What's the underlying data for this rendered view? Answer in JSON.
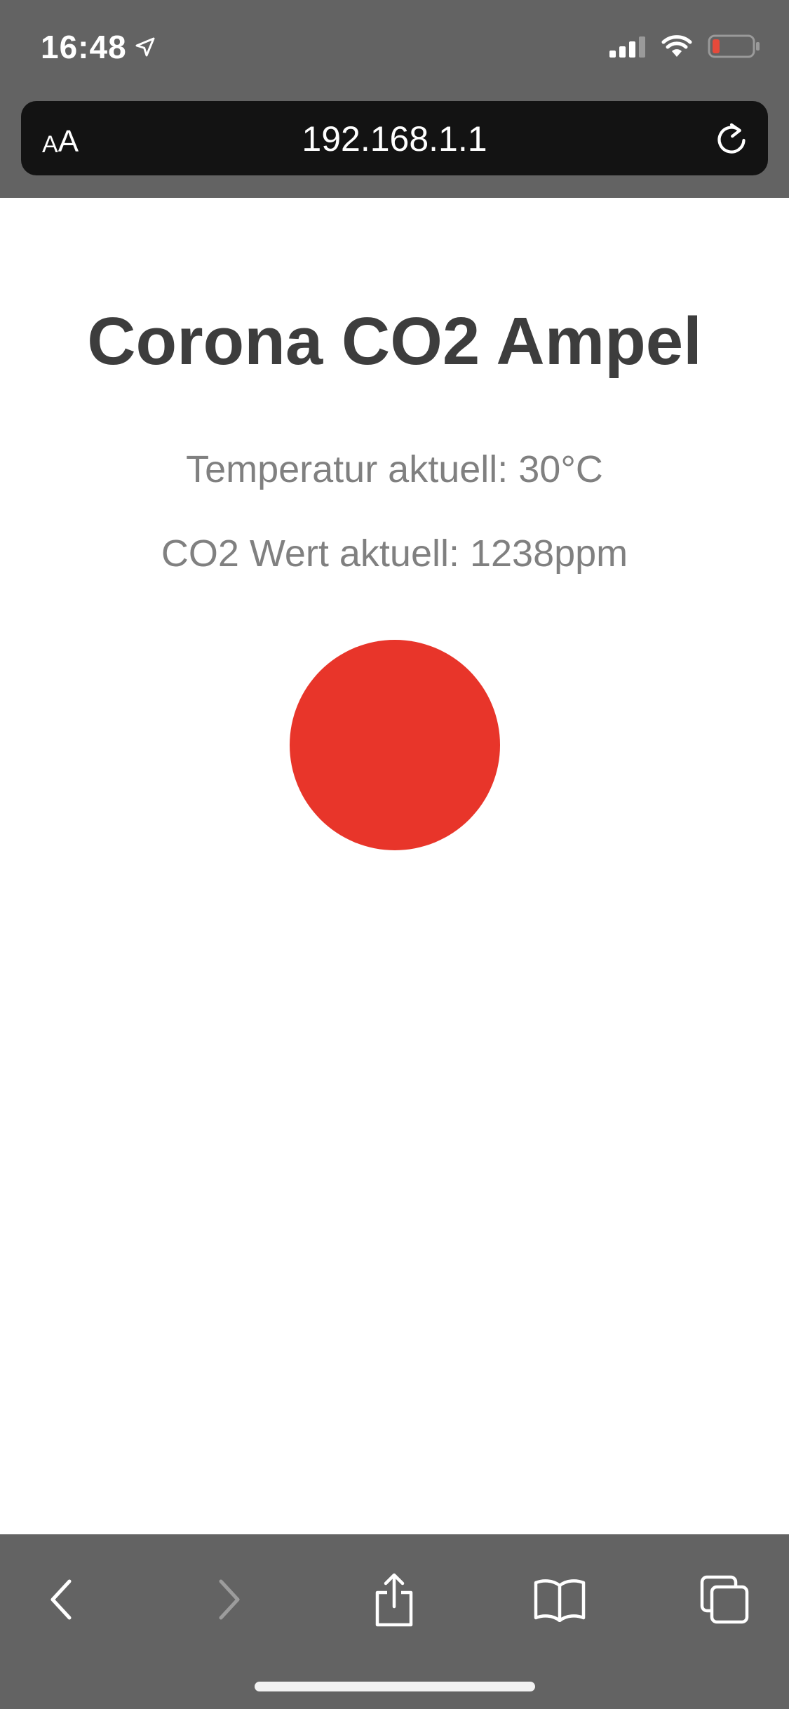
{
  "status_bar": {
    "time": "16:48",
    "icons": [
      "location-arrow-icon",
      "cellular-signal-icon",
      "wifi-icon",
      "battery-low-icon"
    ],
    "battery_color": "#e64a3b"
  },
  "address_bar": {
    "text_size_button": {
      "small": "A",
      "big": "A"
    },
    "url": "192.168.1.1",
    "reload_icon": "reload-icon"
  },
  "page": {
    "title": "Corona CO2 Ampel",
    "temperature_text": "Temperatur aktuell: 30°C",
    "co2_text": "CO2 Wert aktuell: 1238ppm",
    "traffic_light_color": "#e8352a"
  },
  "toolbar": {
    "buttons": [
      {
        "icon": "back-chevron-icon",
        "enabled": true
      },
      {
        "icon": "forward-chevron-icon",
        "enabled": false
      },
      {
        "icon": "share-icon",
        "enabled": true
      },
      {
        "icon": "bookmarks-icon",
        "enabled": true
      },
      {
        "icon": "tabs-icon",
        "enabled": true
      }
    ]
  },
  "colors": {
    "chrome_background": "#636363",
    "url_bar_background": "#131313",
    "title_color": "#3d3d3d",
    "reading_color": "#808080"
  }
}
